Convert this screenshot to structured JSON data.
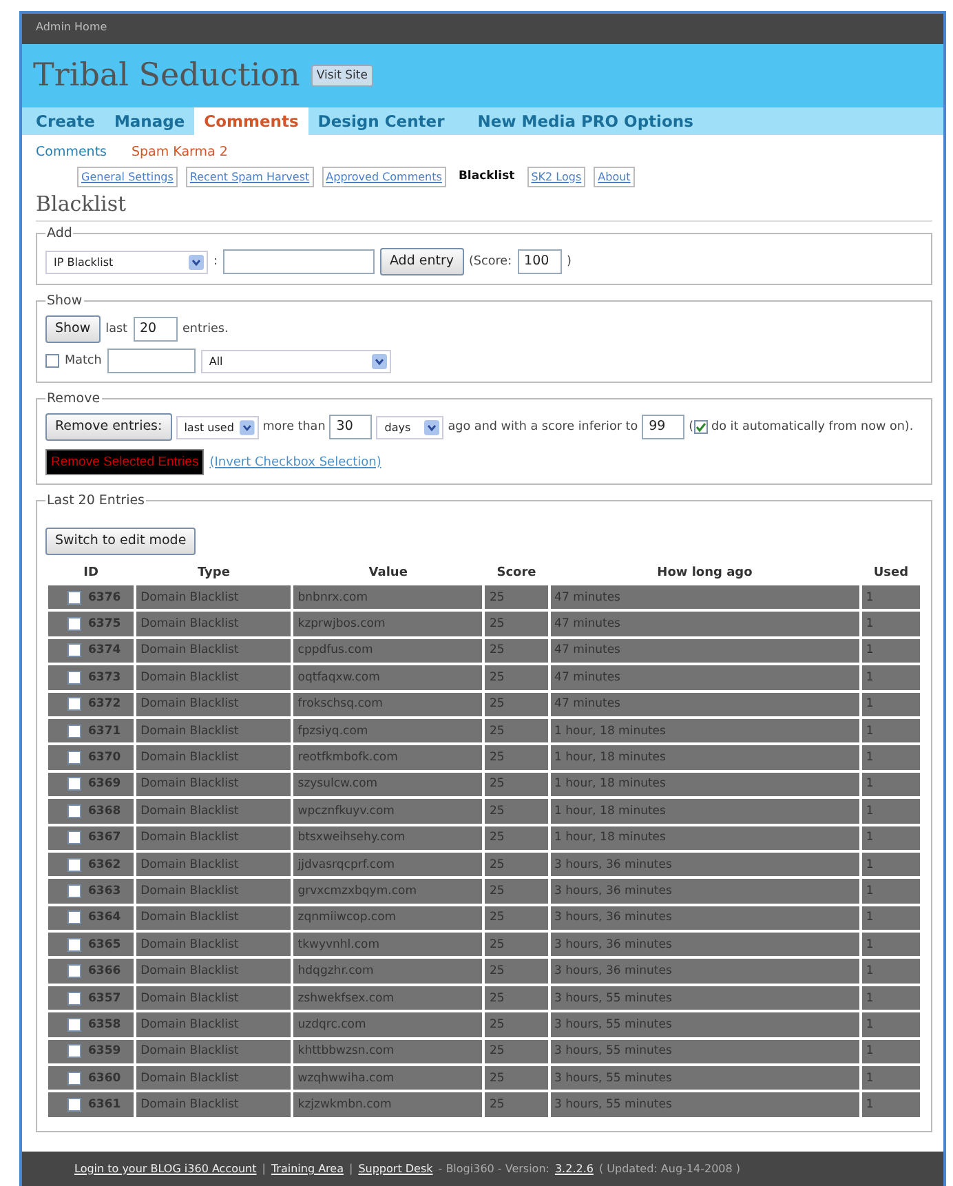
{
  "top_bar": {
    "link": "Admin Home"
  },
  "site": {
    "title": "Tribal Seduction",
    "visit_button": "Visit Site"
  },
  "nav": [
    {
      "label": "Create",
      "selected": false
    },
    {
      "label": "Manage",
      "selected": false
    },
    {
      "label": "Comments",
      "selected": true
    },
    {
      "label": "Design Center",
      "selected": false
    },
    {
      "label": "New Media PRO Options",
      "selected": false
    }
  ],
  "subnav": [
    {
      "label": "Comments",
      "selected": false
    },
    {
      "label": "Spam Karma 2",
      "selected": true
    }
  ],
  "plugin_tabs": [
    {
      "label": "General Settings",
      "selected": false
    },
    {
      "label": "Recent Spam Harvest",
      "selected": false
    },
    {
      "label": "Approved Comments",
      "selected": false
    },
    {
      "label": "Blacklist",
      "selected": true
    },
    {
      "label": "SK2 Logs",
      "selected": false
    },
    {
      "label": "About",
      "selected": false
    }
  ],
  "page_title": "Blacklist",
  "add": {
    "legend": "Add",
    "type_select": "IP Blacklist",
    "separator": ":",
    "button": "Add entry",
    "score_label": "(Score:",
    "score": "100",
    "score_close": ")"
  },
  "show": {
    "legend": "Show",
    "button": "Show",
    "last_label": "last",
    "count": "20",
    "entries_label": "entries.",
    "match_checked": false,
    "match_label": "Match",
    "filter_select": "All"
  },
  "remove": {
    "legend": "Remove",
    "button": "Remove entries:",
    "criterion_select": "last used",
    "more_than": "more than",
    "amount": "30",
    "unit_select": "days",
    "ago_text": "ago and with a score inferior to",
    "score": "99",
    "auto_open": "(",
    "auto_checked": true,
    "auto_label": "do it automatically from now on).",
    "remove_selected_button": "Remove Selected Entries",
    "invert_link": "(Invert Checkbox Selection)"
  },
  "entries": {
    "legend": "Last 20 Entries",
    "edit_button": "Switch to edit mode",
    "columns": [
      "ID",
      "Type",
      "Value",
      "Score",
      "How long ago",
      "Used"
    ],
    "rows": [
      {
        "checked": false,
        "id": "6376",
        "type": "Domain Blacklist",
        "value": "bnbnrx.com",
        "score": "25",
        "ago": "47 minutes",
        "used": "1"
      },
      {
        "checked": false,
        "id": "6375",
        "type": "Domain Blacklist",
        "value": "kzprwjbos.com",
        "score": "25",
        "ago": "47 minutes",
        "used": "1"
      },
      {
        "checked": false,
        "id": "6374",
        "type": "Domain Blacklist",
        "value": "cppdfus.com",
        "score": "25",
        "ago": "47 minutes",
        "used": "1"
      },
      {
        "checked": false,
        "id": "6373",
        "type": "Domain Blacklist",
        "value": "oqtfaqxw.com",
        "score": "25",
        "ago": "47 minutes",
        "used": "1"
      },
      {
        "checked": false,
        "id": "6372",
        "type": "Domain Blacklist",
        "value": "frokschsq.com",
        "score": "25",
        "ago": "47 minutes",
        "used": "1"
      },
      {
        "checked": false,
        "id": "6371",
        "type": "Domain Blacklist",
        "value": "fpzsiyq.com",
        "score": "25",
        "ago": "1 hour, 18 minutes",
        "used": "1"
      },
      {
        "checked": false,
        "id": "6370",
        "type": "Domain Blacklist",
        "value": "reotfkmbofk.com",
        "score": "25",
        "ago": "1 hour, 18 minutes",
        "used": "1"
      },
      {
        "checked": false,
        "id": "6369",
        "type": "Domain Blacklist",
        "value": "szysulcw.com",
        "score": "25",
        "ago": "1 hour, 18 minutes",
        "used": "1"
      },
      {
        "checked": false,
        "id": "6368",
        "type": "Domain Blacklist",
        "value": "wpcznfkuyv.com",
        "score": "25",
        "ago": "1 hour, 18 minutes",
        "used": "1"
      },
      {
        "checked": false,
        "id": "6367",
        "type": "Domain Blacklist",
        "value": "btsxweihsehy.com",
        "score": "25",
        "ago": "1 hour, 18 minutes",
        "used": "1"
      },
      {
        "checked": false,
        "id": "6362",
        "type": "Domain Blacklist",
        "value": "jjdvasrqcprf.com",
        "score": "25",
        "ago": "3 hours, 36 minutes",
        "used": "1"
      },
      {
        "checked": false,
        "id": "6363",
        "type": "Domain Blacklist",
        "value": "grvxcmzxbqym.com",
        "score": "25",
        "ago": "3 hours, 36 minutes",
        "used": "1"
      },
      {
        "checked": false,
        "id": "6364",
        "type": "Domain Blacklist",
        "value": "zqnmiiwcop.com",
        "score": "25",
        "ago": "3 hours, 36 minutes",
        "used": "1"
      },
      {
        "checked": false,
        "id": "6365",
        "type": "Domain Blacklist",
        "value": "tkwyvnhl.com",
        "score": "25",
        "ago": "3 hours, 36 minutes",
        "used": "1"
      },
      {
        "checked": false,
        "id": "6366",
        "type": "Domain Blacklist",
        "value": "hdqgzhr.com",
        "score": "25",
        "ago": "3 hours, 36 minutes",
        "used": "1"
      },
      {
        "checked": false,
        "id": "6357",
        "type": "Domain Blacklist",
        "value": "zshwekfsex.com",
        "score": "25",
        "ago": "3 hours, 55 minutes",
        "used": "1"
      },
      {
        "checked": false,
        "id": "6358",
        "type": "Domain Blacklist",
        "value": "uzdqrc.com",
        "score": "25",
        "ago": "3 hours, 55 minutes",
        "used": "1"
      },
      {
        "checked": false,
        "id": "6359",
        "type": "Domain Blacklist",
        "value": "khttbbwzsn.com",
        "score": "25",
        "ago": "3 hours, 55 minutes",
        "used": "1"
      },
      {
        "checked": false,
        "id": "6360",
        "type": "Domain Blacklist",
        "value": "wzqhwwiha.com",
        "score": "25",
        "ago": "3 hours, 55 minutes",
        "used": "1"
      },
      {
        "checked": false,
        "id": "6361",
        "type": "Domain Blacklist",
        "value": "kzjzwkmbn.com",
        "score": "25",
        "ago": "3 hours, 55 minutes",
        "used": "1"
      }
    ]
  },
  "footer": {
    "links": [
      "Login to your BLOG i360 Account",
      "Training Area",
      "Support Desk"
    ],
    "separator": "|",
    "product_text": "- Blogi360 - Version:",
    "version_link": "3.2.2.6",
    "updated_text": "( Updated: Aug-14-2008 )"
  }
}
